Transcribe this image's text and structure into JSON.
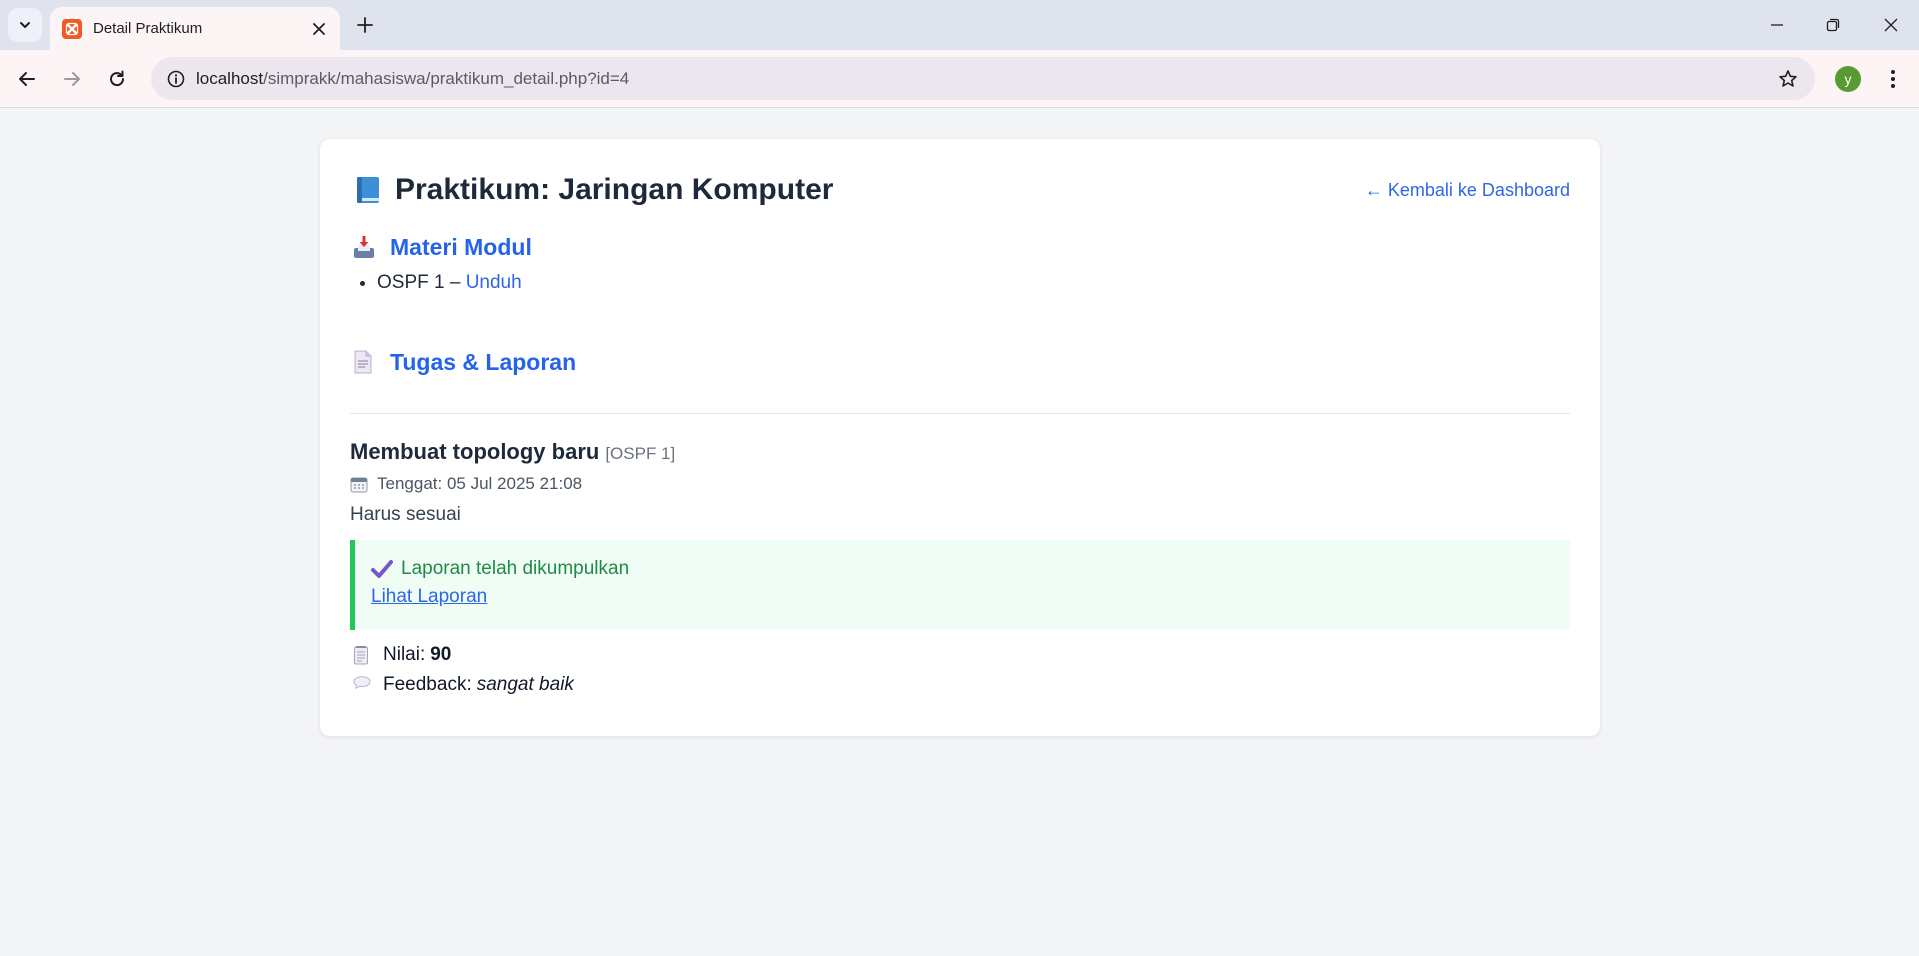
{
  "browser": {
    "tab_title": "Detail Praktikum",
    "url_host": "localhost",
    "url_path": "/simprakk/mahasiswa/praktikum_detail.php?id=4",
    "profile_initial": "y"
  },
  "page": {
    "title": "Praktikum: Jaringan Komputer",
    "back_link": "← Kembali ke Dashboard",
    "materi_heading": "Materi Modul",
    "modules": [
      {
        "name": "OSPF 1",
        "separator": " – ",
        "link_label": "Unduh"
      }
    ],
    "tugas_heading": "Tugas & Laporan",
    "task": {
      "title": "Membuat topology baru",
      "tag": "[OSPF 1]",
      "deadline_label": "Tenggat:",
      "deadline_value": "05 Jul 2025 21:08",
      "description": "Harus sesuai",
      "status_text": "Laporan telah dikumpulkan",
      "report_link": "Lihat Laporan",
      "grade_label": "Nilai:",
      "grade_value": "90",
      "feedback_label": "Feedback:",
      "feedback_value": "sangat baik"
    }
  },
  "colors": {
    "accent": "#2563eb",
    "link": "#2f66e6",
    "success_border": "#22c55e",
    "success_bg": "#effdf4",
    "success_text": "#218a4a"
  },
  "icons": [
    "tab-list-icon",
    "xampp-favicon",
    "close-icon",
    "plus-icon",
    "minimize-icon",
    "restore-icon",
    "window-close-icon",
    "back-arrow-icon",
    "forward-arrow-icon",
    "reload-icon",
    "site-info-icon",
    "bookmark-star-icon",
    "kebab-menu-icon",
    "book-icon",
    "inbox-tray-icon",
    "page-document-icon",
    "calendar-icon",
    "check-mark-icon",
    "notepad-icon",
    "speech-bubble-icon"
  ]
}
